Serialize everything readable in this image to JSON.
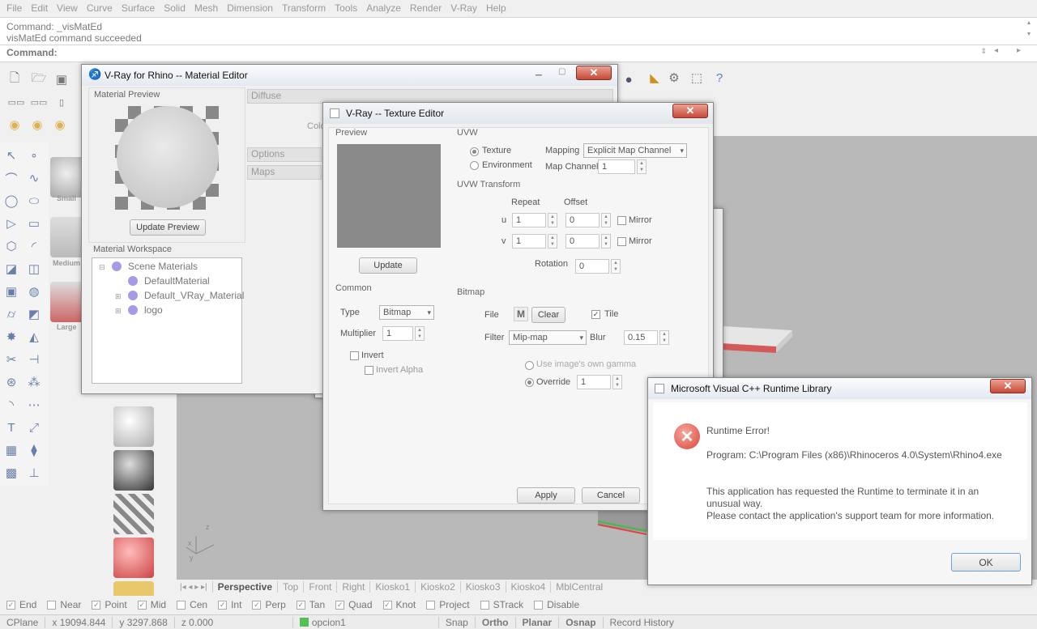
{
  "menu": [
    "File",
    "Edit",
    "View",
    "Curve",
    "Surface",
    "Solid",
    "Mesh",
    "Dimension",
    "Transform",
    "Tools",
    "Analyze",
    "Render",
    "V-Ray",
    "Help"
  ],
  "command": {
    "history": [
      "Command: _visMatEd",
      "visMatEd command succeeded"
    ],
    "prompt": "Command:"
  },
  "material_thumbs": [
    "Small",
    "Medium",
    "Large"
  ],
  "material_editor": {
    "title": "V-Ray for Rhino -- Material Editor",
    "preview_label": "Material Preview",
    "update_preview": "Update Preview",
    "workspace_label": "Material Workspace",
    "tree": {
      "root": "Scene Materials",
      "items": [
        "DefaultMaterial",
        "Default_VRay_Material",
        "logo"
      ]
    },
    "sections": {
      "diffuse": "Diffuse",
      "options": "Options",
      "maps": "Maps",
      "color_partial": "Colo"
    }
  },
  "texture_editor": {
    "title": "V-Ray -- Texture Editor",
    "preview_label": "Preview",
    "update": "Update",
    "uvw": {
      "label": "UVW",
      "texture": "Texture",
      "environment": "Environment",
      "mapping_label": "Mapping",
      "mapping_value": "Explicit Map Channel",
      "map_channel_label": "Map Channel",
      "map_channel_value": "1"
    },
    "uvw_transform": {
      "label": "UVW Transform",
      "repeat": "Repeat",
      "offset": "Offset",
      "u": "u",
      "v": "v",
      "u_repeat": "1",
      "u_offset": "0",
      "v_repeat": "1",
      "v_offset": "0",
      "mirror": "Mirror",
      "rotation_label": "Rotation",
      "rotation_value": "0"
    },
    "common": {
      "label": "Common",
      "type_label": "Type",
      "type_value": "Bitmap",
      "multiplier_label": "Multiplier",
      "multiplier_value": "1",
      "invert": "Invert",
      "invert_alpha": "Invert Alpha"
    },
    "bitmap": {
      "label": "Bitmap",
      "file_label": "File",
      "m_button": "M",
      "clear": "Clear",
      "tile": "Tile",
      "filter_label": "Filter",
      "filter_value": "Mip-map",
      "blur_label": "Blur",
      "blur_value": "0.15",
      "own_gamma": "Use image's own gamma",
      "override": "Override",
      "override_value": "1"
    },
    "apply": "Apply",
    "cancel": "Cancel"
  },
  "error_dialog": {
    "title": "Microsoft Visual C++ Runtime Library",
    "heading": "Runtime Error!",
    "program": "Program: C:\\Program Files (x86)\\Rhinoceros 4.0\\System\\Rhino4.exe",
    "message1": "This application has requested the Runtime to terminate it in an unusual way.",
    "message2": "Please contact the application's support team for more information.",
    "ok": "OK"
  },
  "viewport_tabs": [
    "Perspective",
    "Top",
    "Front",
    "Right",
    "Kiosko1",
    "Kiosko2",
    "Kiosko3",
    "Kiosko4",
    "MblCentral"
  ],
  "active_tab": "Perspective",
  "osnaps": [
    {
      "label": "End",
      "checked": true
    },
    {
      "label": "Near",
      "checked": false
    },
    {
      "label": "Point",
      "checked": true
    },
    {
      "label": "Mid",
      "checked": true
    },
    {
      "label": "Cen",
      "checked": false
    },
    {
      "label": "Int",
      "checked": true
    },
    {
      "label": "Perp",
      "checked": true
    },
    {
      "label": "Tan",
      "checked": true
    },
    {
      "label": "Quad",
      "checked": true
    },
    {
      "label": "Knot",
      "checked": true
    },
    {
      "label": "Project",
      "checked": false
    },
    {
      "label": "STrack",
      "checked": false
    },
    {
      "label": "Disable",
      "checked": false
    }
  ],
  "status": {
    "cplane": "CPlane",
    "x": "x 19094.844",
    "y": "y 3297.868",
    "z": "z 0.000",
    "layer": "opcion1",
    "snap": "Snap",
    "ortho": "Ortho",
    "planar": "Planar",
    "osnap": "Osnap",
    "record": "Record History"
  },
  "colors": {
    "close_red": "#c84a38",
    "layer_green": "#55c155",
    "error_red": "#d9453a"
  }
}
